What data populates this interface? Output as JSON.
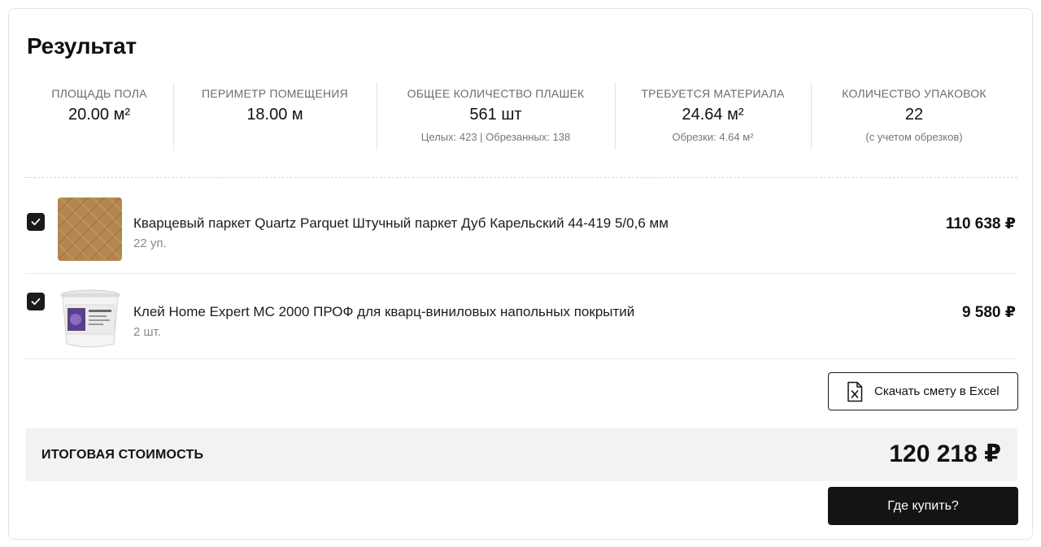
{
  "title": "Результат",
  "stats": [
    {
      "label": "Площадь пола",
      "value": "20.00 м²",
      "sub": ""
    },
    {
      "label": "Периметр помещения",
      "value": "18.00 м",
      "sub": ""
    },
    {
      "label": "Общее количество плашек",
      "value": "561 шт",
      "sub": "Целых: 423 | Обрезанных: 138"
    },
    {
      "label": "Требуется материала",
      "value": "24.64 м²",
      "sub": "Обрезки: 4.64 м²"
    },
    {
      "label": "Количество упаковок",
      "value": "22",
      "sub": "(с учетом обрезков)"
    }
  ],
  "items": [
    {
      "checked": true,
      "name": "Кварцевый паркет Quartz Parquet Штучный паркет Дуб Карельский 44-419 5/0,6 мм",
      "quantity": "22 уп.",
      "price": "110 638 ₽"
    },
    {
      "checked": true,
      "name": "Клей Home Expert MC 2000 ПРОФ для кварц-виниловых напольных покрытий",
      "quantity": "2 шт.",
      "price": "9 580 ₽"
    }
  ],
  "excel_button": {
    "label": "Скачать смету в Excel",
    "icon": "excel-file-icon"
  },
  "total": {
    "label": "Итоговая стоимость",
    "value": "120 218 ₽"
  },
  "buy_button": {
    "label": "Где купить?"
  },
  "colors": {
    "primary": "#141414",
    "panel": "#f2f2f2",
    "muted": "#8a8a8a"
  }
}
